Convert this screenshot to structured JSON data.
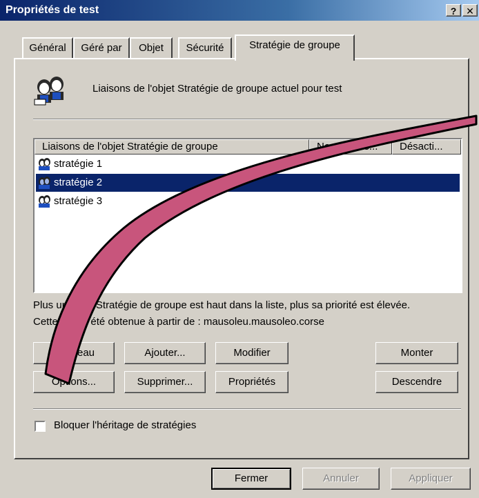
{
  "window": {
    "title": "Propriétés de test",
    "help_button": "?",
    "close_button": "✕"
  },
  "tabs": [
    {
      "label": "Général",
      "active": false
    },
    {
      "label": "Géré par",
      "active": false
    },
    {
      "label": "Objet",
      "active": false
    },
    {
      "label": "Sécurité",
      "active": false
    },
    {
      "label": "Stratégie de groupe",
      "active": true
    }
  ],
  "panel": {
    "icon": "group-policy-users-icon",
    "description": "Liaisons de l'objet Stratégie de groupe actuel pour test"
  },
  "list": {
    "columns": [
      "Liaisons de l'objet Stratégie de groupe",
      "Ne pas pas...",
      "Désacti..."
    ],
    "items": [
      {
        "name": "stratégie 1",
        "icon": "gpo-icon",
        "selected": false
      },
      {
        "name": "stratégie 2",
        "icon": "gpo-icon",
        "selected": true
      },
      {
        "name": "stratégie 3",
        "icon": "gpo-icon",
        "selected": false
      }
    ]
  },
  "info": {
    "line1": "Plus un objet Stratégie de groupe est haut dans la liste, plus sa priorité est élevée.",
    "line2": "Cette liste a été obtenue à partir de : mausoleu.mausoleo.corse"
  },
  "buttons": {
    "nouveau": "Nouveau",
    "ajouter": "Ajouter...",
    "modifier": "Modifier",
    "monter": "Monter",
    "options": "Options...",
    "supprimer": "Supprimer...",
    "proprietes": "Propriétés",
    "descendre": "Descendre"
  },
  "checkbox": {
    "label": "Bloquer l'héritage de stratégies",
    "checked": false
  },
  "footer": {
    "fermer": "Fermer",
    "annuler": "Annuler",
    "appliquer": "Appliquer"
  },
  "overlay": {
    "arrow_fill": "#c8557c",
    "arrow_outline": "#000000"
  }
}
